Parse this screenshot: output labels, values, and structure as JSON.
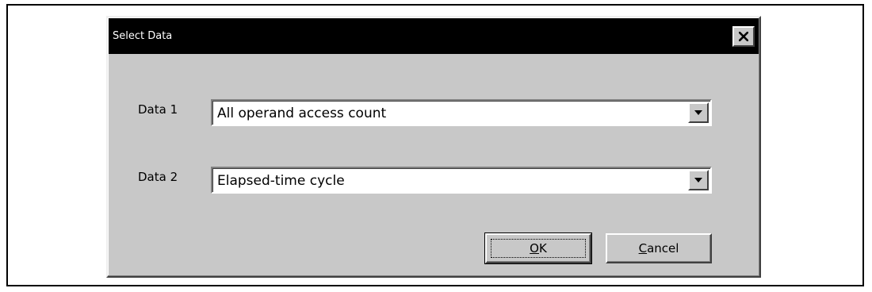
{
  "dialog": {
    "title": "Select Data",
    "close_icon": "close-icon"
  },
  "fields": [
    {
      "label": "Data 1",
      "value": "All operand access count"
    },
    {
      "label": "Data 2",
      "value": "Elapsed-time cycle"
    }
  ],
  "buttons": {
    "ok": {
      "mnemonic": "O",
      "rest": "K"
    },
    "cancel": {
      "mnemonic": "C",
      "rest": "ancel"
    }
  },
  "colors": {
    "dialog_face": "#c8c8c8",
    "title_bar": "#000000",
    "title_text": "#ffffff"
  }
}
